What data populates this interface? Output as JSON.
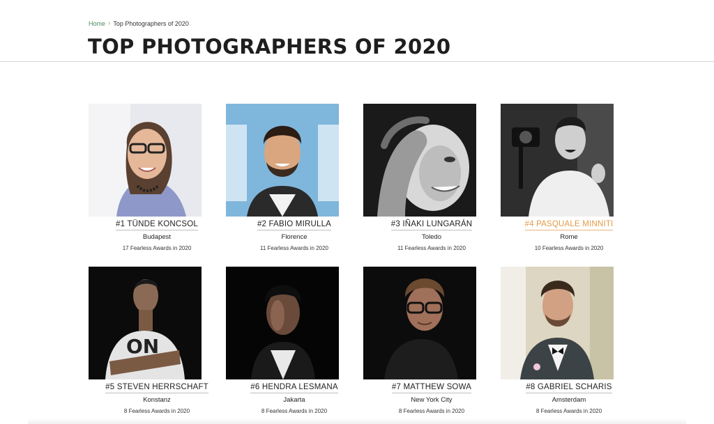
{
  "breadcrumb": {
    "home": "Home",
    "separator": "›",
    "current": "Top Photographers of 2020"
  },
  "page": {
    "title": "TOP PHOTOGRAPHERS OF 2020"
  },
  "photographers": [
    {
      "name": "#1 TÜNDE KONCSOL",
      "city": "Budapest",
      "awards": "17 Fearless Awards in 2020"
    },
    {
      "name": "#2 FABIO MIRULLA",
      "city": "Florence",
      "awards": "11 Fearless Awards in 2020"
    },
    {
      "name": "#3 IÑAKI LUNGARÁN",
      "city": "Toledo",
      "awards": "11 Fearless Awards in 2020"
    },
    {
      "name": "#4 PASQUALE MINNITI",
      "city": "Rome",
      "awards": "10 Fearless Awards in 2020"
    },
    {
      "name": "#5 STEVEN HERRSCHAFT",
      "city": "Konstanz",
      "awards": "8 Fearless Awards in 2020"
    },
    {
      "name": "#6 HENDRA LESMANA",
      "city": "Jakarta",
      "awards": "8 Fearless Awards in 2020"
    },
    {
      "name": "#7 MATTHEW SOWA",
      "city": "New York City",
      "awards": "8 Fearless Awards in 2020"
    },
    {
      "name": "#8 GABRIEL SCHARIS",
      "city": "Amsterdam",
      "awards": "8 Fearless Awards in 2020"
    }
  ],
  "colors": {
    "link_green": "#4a8a5e",
    "hover_orange": "#e39a45"
  }
}
